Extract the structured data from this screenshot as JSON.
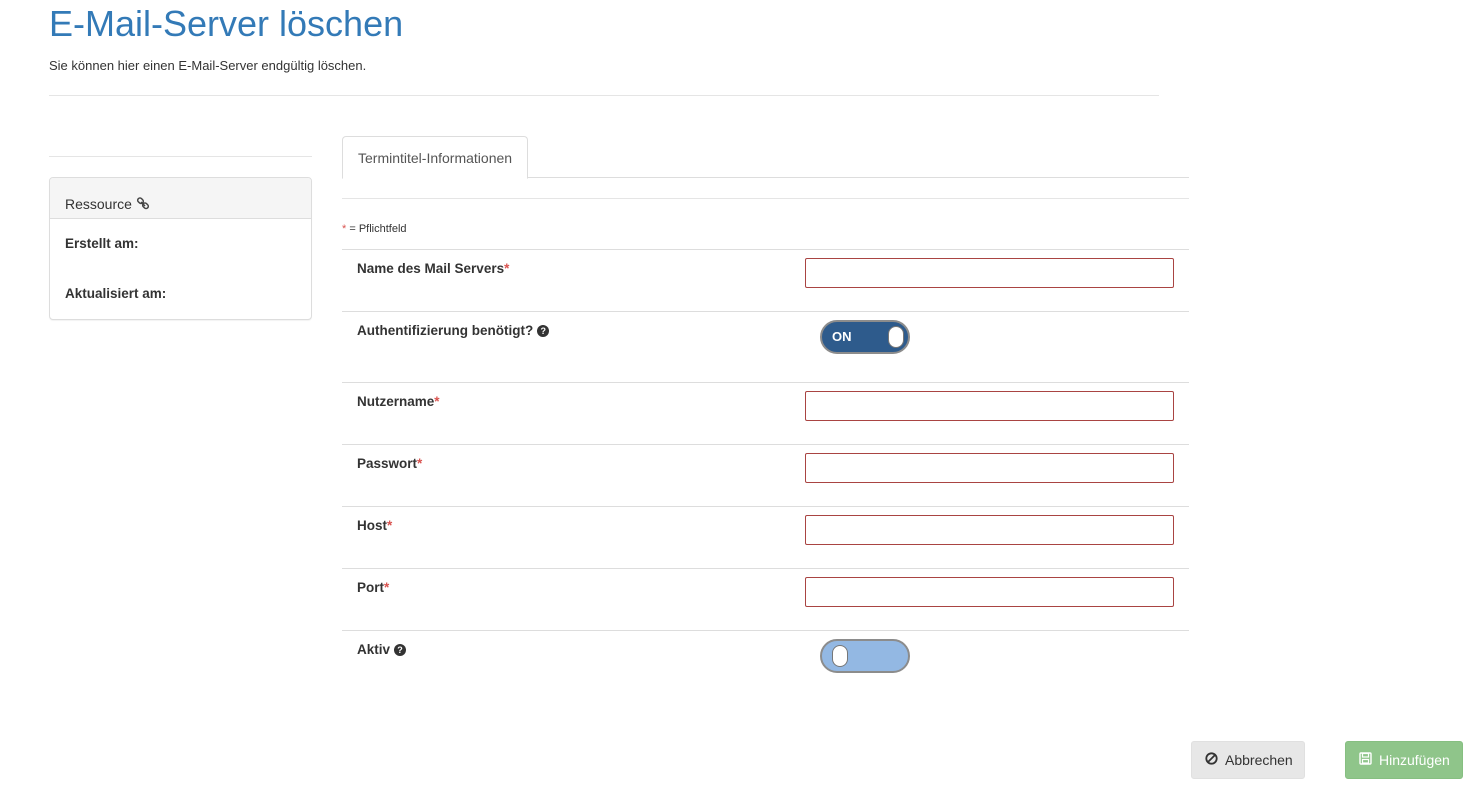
{
  "header": {
    "title": "E-Mail-Server löschen",
    "subtitle": "Sie können hier einen E-Mail-Server endgültig löschen."
  },
  "sidebar": {
    "panel_title": "Ressource",
    "panel_icon": "link-icon",
    "created_label": "Erstellt am:",
    "updated_label": "Aktualisiert am:"
  },
  "tabs": [
    {
      "label": "Termintitel-Informationen",
      "active": true
    }
  ],
  "form": {
    "required_marker": "*",
    "required_note": "= Pflichtfeld",
    "fields": {
      "mail_server_name": {
        "label": "Name des Mail Servers",
        "required": "*",
        "value": ""
      },
      "auth_required": {
        "label": "Authentifizierung benötigt?",
        "help_icon": "question-circle-icon",
        "toggle_text": "ON",
        "state": "on"
      },
      "username": {
        "label": "Nutzername",
        "required": "*",
        "value": ""
      },
      "password": {
        "label": "Passwort",
        "required": "*",
        "value": ""
      },
      "host": {
        "label": "Host",
        "required": "*",
        "value": ""
      },
      "port": {
        "label": "Port",
        "required": "*",
        "value": ""
      },
      "active": {
        "label": "Aktiv",
        "help_icon": "question-circle-icon",
        "state": "off"
      }
    }
  },
  "actions": {
    "cancel_label": "Abbrechen",
    "cancel_icon": "ban-icon",
    "add_label": "Hinzufügen",
    "add_icon": "save-icon"
  },
  "colors": {
    "title": "#337ab7",
    "input_error_border": "#a94442",
    "required_marker": "#d9534f",
    "toggle_on": "#2e5b8c",
    "toggle_off": "#93b8e3",
    "add_button": "#8fc58a",
    "cancel_button": "#e7e7e7"
  }
}
